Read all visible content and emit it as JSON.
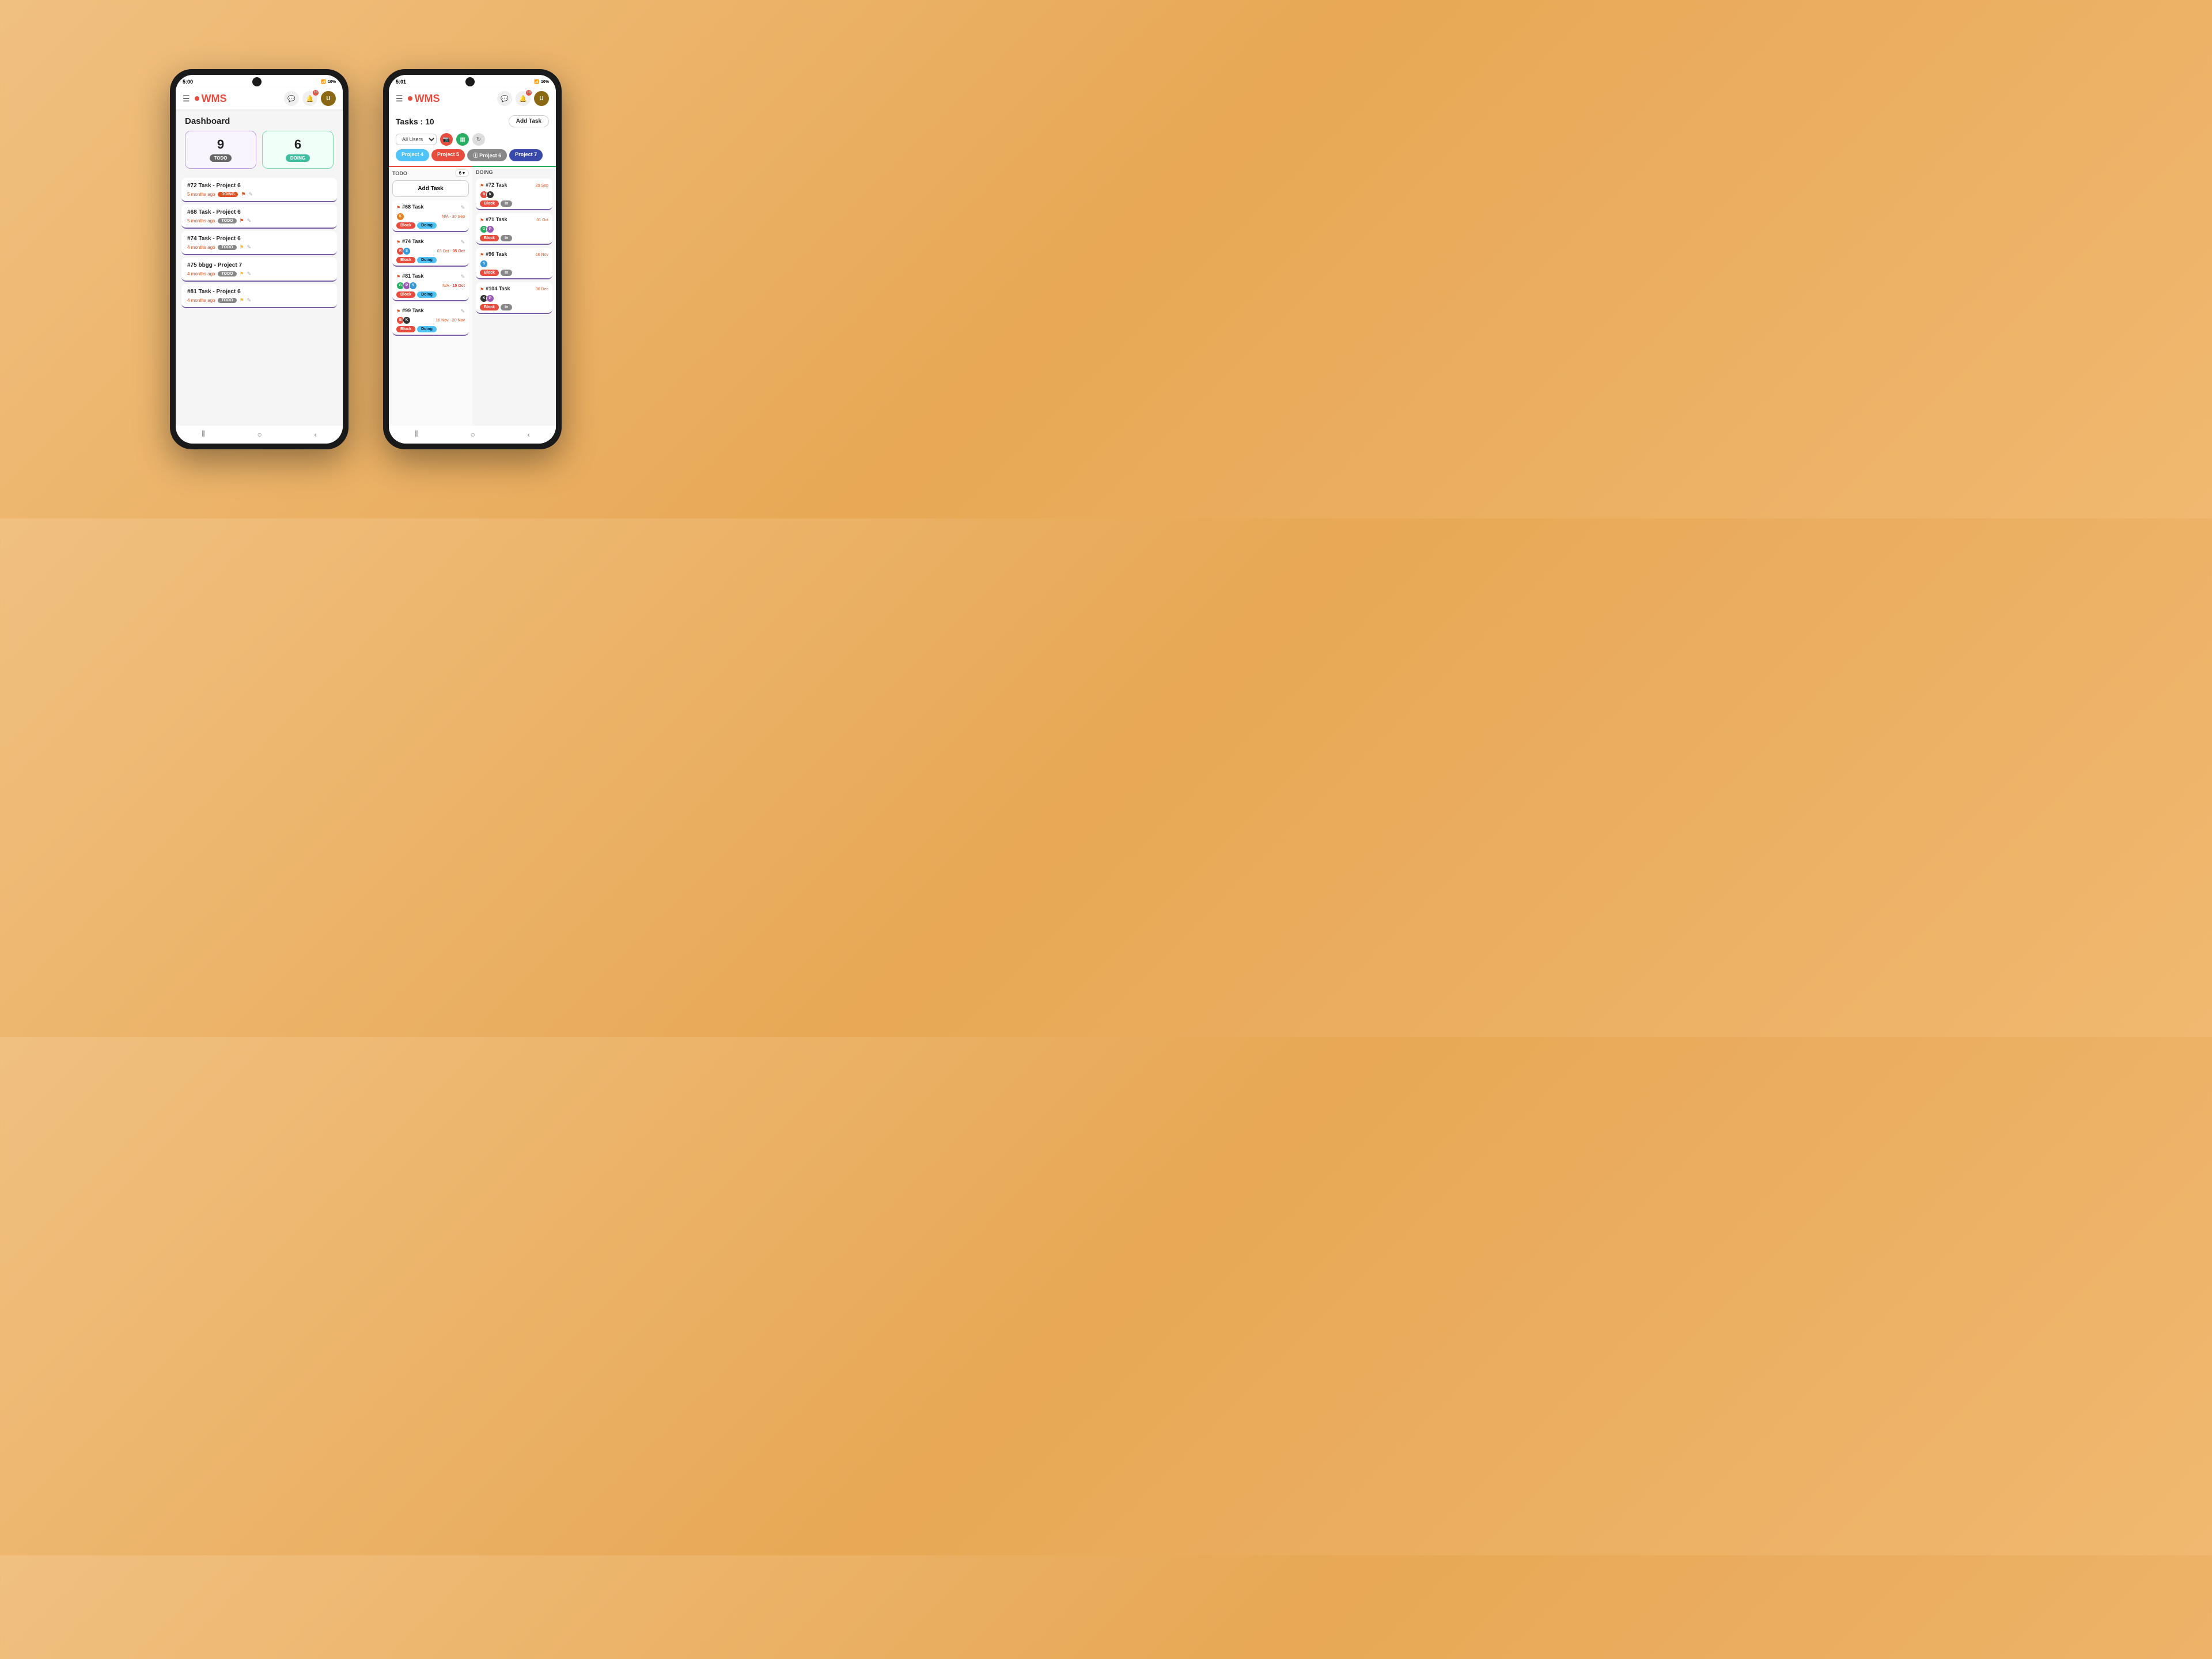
{
  "phone1": {
    "status_time": "5:00",
    "battery": "10%",
    "logo": "WMS",
    "page_title": "Dashboard",
    "stats": [
      {
        "value": "9",
        "label": "TODO",
        "type": "todo"
      },
      {
        "value": "6",
        "label": "DOING",
        "type": "doing"
      }
    ],
    "tasks": [
      {
        "title": "#72 Task - Project 6",
        "time_ago": "5 months ago",
        "status": "DOING",
        "type": "doing"
      },
      {
        "title": "#68 Task - Project 6",
        "time_ago": "5 months ago",
        "status": "TODO",
        "type": "todo"
      },
      {
        "title": "#74 Task - Project 6",
        "time_ago": "4 months ago",
        "status": "TODO",
        "type": "todo"
      },
      {
        "title": "#75 bbgg - Project 7",
        "time_ago": "4 months ago",
        "status": "TODO",
        "type": "todo"
      },
      {
        "title": "#81 Task - Project 6",
        "time_ago": "4 months ago",
        "status": "TODO",
        "type": "todo"
      }
    ]
  },
  "phone2": {
    "status_time": "5:01",
    "battery": "10%",
    "logo": "WMS",
    "tasks_count": "Tasks : 10",
    "add_task_btn": "Add Task",
    "filter_user": "All Users",
    "projects": [
      {
        "label": "Project 4",
        "class": "p4"
      },
      {
        "label": "Project 5",
        "class": "p5"
      },
      {
        "label": "ⓘ Project 6",
        "class": "p6"
      },
      {
        "label": "Project 7",
        "class": "p7"
      }
    ],
    "todo_col": {
      "title": "TODO",
      "count": "6",
      "add_task": "Add Task",
      "tasks": [
        {
          "title": "#68 Task",
          "flag": true,
          "avatars": [
            {
              "letter": "K",
              "color": "#e67e22"
            }
          ],
          "date": "N/A - 30 Sep",
          "btns": [
            "Block",
            "Doing"
          ]
        },
        {
          "title": "#74 Task",
          "flag": true,
          "avatars": [
            {
              "letter": "R",
              "color": "#e74c3c"
            },
            {
              "letter": "S",
              "color": "#3498db"
            }
          ],
          "date": "03 Oct - 05 Oct",
          "date_highlight": true,
          "btns": [
            "Block",
            "Doing"
          ]
        },
        {
          "title": "#81 Task",
          "flag": true,
          "avatars": [
            {
              "letter": "G",
              "color": "#27ae60"
            },
            {
              "letter": "P",
              "color": "#9b59b6"
            },
            {
              "letter": "S",
              "color": "#3498db"
            }
          ],
          "date": "N/A - 15 Oct",
          "date_highlight": true,
          "btns": [
            "Block",
            "Doing"
          ]
        },
        {
          "title": "#99 Task",
          "flag": true,
          "avatars": [
            {
              "letter": "B",
              "color": "#e74c3c"
            },
            {
              "letter": "K",
              "color": "#333"
            }
          ],
          "date": "16 Nov - 20 Nov",
          "btns": [
            "Block",
            "Doing"
          ]
        }
      ]
    },
    "doing_col": {
      "title": "DOING",
      "tasks": [
        {
          "title": "#72 Task",
          "flag": true,
          "avatars": [
            {
              "letter": "B",
              "color": "#e74c3c"
            },
            {
              "letter": "K",
              "color": "#333"
            }
          ],
          "date": "29 Sep",
          "btns": [
            "Block",
            "In"
          ]
        },
        {
          "title": "#71 Task",
          "flag": true,
          "avatars": [
            {
              "letter": "G",
              "color": "#27ae60"
            },
            {
              "letter": "P",
              "color": "#9b59b6"
            }
          ],
          "date": "01 Oct",
          "btns": [
            "Block",
            "In"
          ]
        },
        {
          "title": "#96 Task",
          "flag": true,
          "avatars": [
            {
              "letter": "S",
              "color": "#3498db"
            }
          ],
          "date": "16 Nov",
          "btns": [
            "Block",
            "In"
          ]
        },
        {
          "title": "#104 Task",
          "flag": true,
          "avatars": [
            {
              "letter": "K",
              "color": "#333"
            },
            {
              "letter": "P",
              "color": "#9b59b6"
            }
          ],
          "date": "30 Dec",
          "btns": [
            "Block",
            "In"
          ]
        }
      ]
    }
  }
}
